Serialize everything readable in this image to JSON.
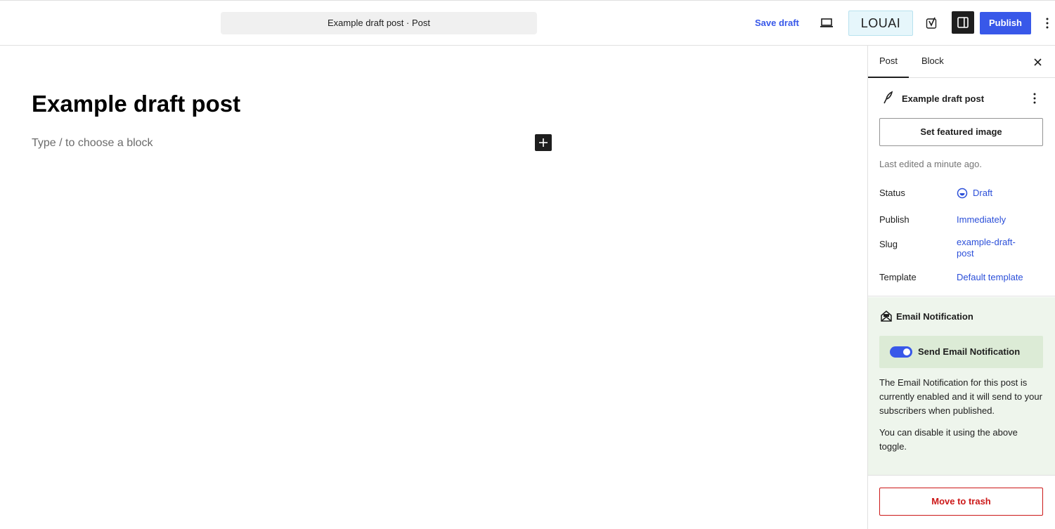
{
  "header": {
    "document_title": "Example draft post · Post",
    "save_draft_label": "Save draft",
    "louai_label": "LOUAI",
    "publish_label": "Publish"
  },
  "editor": {
    "title": "Example draft post",
    "placeholder": "Type / to choose a block"
  },
  "sidebar": {
    "tabs": [
      {
        "label": "Post"
      },
      {
        "label": "Block"
      }
    ],
    "post_card_title": "Example draft post",
    "featured_image_label": "Set featured image",
    "last_edited": "Last edited a minute ago.",
    "rows": {
      "status": {
        "label": "Status",
        "value": "Draft"
      },
      "publish": {
        "label": "Publish",
        "value": "Immediately"
      },
      "slug": {
        "label": "Slug",
        "value": "example-draft-post"
      },
      "template": {
        "label": "Template",
        "value": "Default template"
      }
    },
    "email": {
      "title": "Email Notification",
      "toggle_label": "Send Email Notification",
      "toggle_on": true,
      "desc1": "The Email Notification for this post is currently enabled and it will send to your subscribers when published.",
      "desc2": "You can disable it using the above toggle."
    },
    "trash_label": "Move to trash"
  },
  "colors": {
    "accent": "#3858e9",
    "danger": "#cc1818",
    "email_bg": "#eef5ec"
  }
}
